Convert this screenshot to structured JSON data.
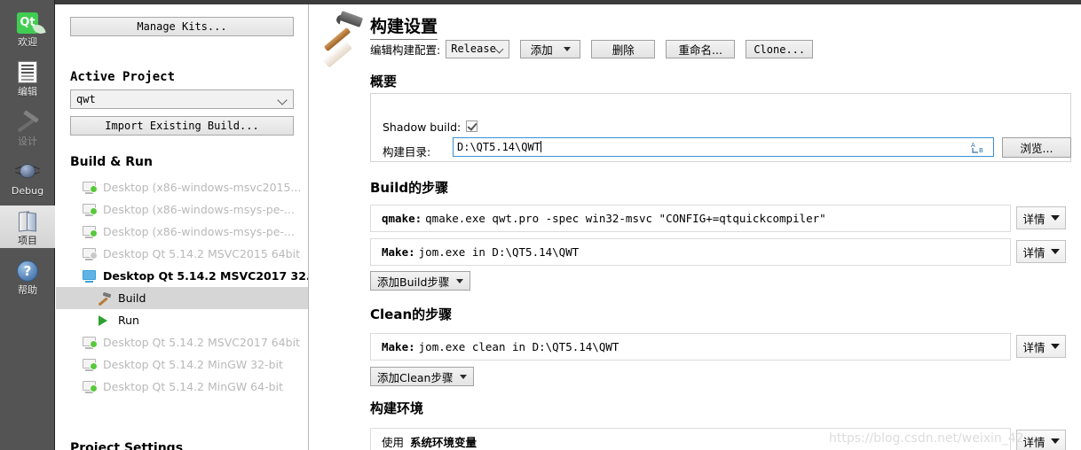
{
  "modebar": {
    "items": [
      {
        "label": "欢迎",
        "icon": "qt-welcome-icon",
        "name": "mode-welcome",
        "state": "normal"
      },
      {
        "label": "编辑",
        "icon": "edit-document-icon",
        "name": "mode-edit",
        "state": "normal"
      },
      {
        "label": "设计",
        "icon": "design-brush-icon",
        "name": "mode-design",
        "state": "disabled"
      },
      {
        "label": "Debug",
        "icon": "debug-bug-icon",
        "name": "mode-debug",
        "state": "normal"
      },
      {
        "label": "项目",
        "icon": "projects-book-icon",
        "name": "mode-projects",
        "state": "selected"
      },
      {
        "label": "帮助",
        "icon": "help-question-icon",
        "name": "mode-help",
        "state": "normal"
      }
    ]
  },
  "leftpanel": {
    "manage_kits_label": "Manage Kits...",
    "active_project_heading": "Active Project",
    "active_project_value": "qwt",
    "import_build_label": "Import Existing Build...",
    "build_run_heading": "Build & Run",
    "kits": [
      {
        "label": "Desktop (x86-windows-msvc2015...",
        "state": "inactive",
        "icon": "kit-screen-add-icon"
      },
      {
        "label": "Desktop (x86-windows-msys-pe-...",
        "state": "inactive",
        "icon": "kit-screen-add-icon"
      },
      {
        "label": "Desktop (x86-windows-msys-pe-...",
        "state": "inactive",
        "icon": "kit-screen-add-icon"
      },
      {
        "label": "Desktop Qt 5.14.2 MSVC2015 64bit",
        "state": "warning",
        "icon": "kit-screen-warning-icon"
      },
      {
        "label": "Desktop Qt 5.14.2 MSVC2017 32...",
        "state": "active",
        "icon": "kit-screen-active-icon"
      }
    ],
    "active_kit_children": [
      {
        "label": "Build",
        "icon": "hammer-icon",
        "selected": true
      },
      {
        "label": "Run",
        "icon": "play-icon",
        "selected": false
      }
    ],
    "kits_after": [
      {
        "label": "Desktop Qt 5.14.2 MSVC2017 64bit",
        "state": "inactive",
        "icon": "kit-screen-add-icon"
      },
      {
        "label": "Desktop Qt 5.14.2 MinGW 32-bit",
        "state": "inactive",
        "icon": "kit-screen-add-icon"
      },
      {
        "label": "Desktop Qt 5.14.2 MinGW 64-bit",
        "state": "inactive",
        "icon": "kit-screen-add-icon"
      }
    ],
    "project_settings_heading": "Project Settings"
  },
  "content": {
    "page_title": "构建设置",
    "toolbar": {
      "edit_config_label": "编辑构建配置:",
      "config_value": "Release",
      "add_label": "添加",
      "remove_label": "删除",
      "rename_label": "重命名...",
      "clone_label": "Clone..."
    },
    "summary": {
      "heading": "概要",
      "shadow_build_label": "Shadow build:",
      "shadow_build_checked": true,
      "build_dir_label": "构建目录:",
      "build_dir_value": "D:\\QT5.14\\QWT",
      "ime_icon_text": "A→B",
      "browse_label": "浏览..."
    },
    "build_steps": {
      "heading": "Build的步骤",
      "steps": [
        {
          "name": "qmake:",
          "command": "qmake.exe qwt.pro -spec win32-msvc \"CONFIG+=qtquickcompiler\"",
          "detail_label": "详情"
        },
        {
          "name": "Make:",
          "command": "jom.exe in D:\\QT5.14\\QWT",
          "detail_label": "详情"
        }
      ],
      "add_step_label": "添加Build步骤"
    },
    "clean_steps": {
      "heading": "Clean的步骤",
      "steps": [
        {
          "name": "Make:",
          "command": "jom.exe clean in D:\\QT5.14\\QWT",
          "detail_label": "详情"
        }
      ],
      "add_step_label": "添加Clean步骤"
    },
    "build_env": {
      "heading": "构建环境",
      "use_label": "使用",
      "env_value": "系统环境变量",
      "detail_label": "详情"
    },
    "watermark": "https://blog.csdn.net/weixin_42"
  }
}
